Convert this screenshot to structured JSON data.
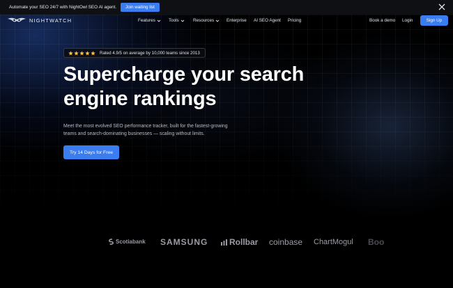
{
  "announcement": {
    "text": "Automate your SEO 24/7 with NightOwl SEO AI agent.",
    "join_label": "Join waiting list"
  },
  "nav": {
    "logo_text": "NIGHTWATCH",
    "items": [
      {
        "label": "Features",
        "dropdown": true
      },
      {
        "label": "Tools",
        "dropdown": true
      },
      {
        "label": "Resources",
        "dropdown": true
      },
      {
        "label": "Enterprise",
        "dropdown": false
      },
      {
        "label": "AI SEO Agent",
        "dropdown": false
      },
      {
        "label": "Pricing",
        "dropdown": false
      }
    ],
    "book_demo": "Book a demo",
    "login": "Login",
    "signup": "Sign Up"
  },
  "hero": {
    "stars": 5,
    "rating_text": "Rated 4.9/5 on average by 10,000 teams since 2013",
    "headline_line1": "Supercharge your search",
    "headline_line2": "engine rankings",
    "subtext": "Meet the most evolved SEO performance tracker, built for the fastest-growing teams and search-dominating businesses — scaling without limits.",
    "cta": "Try 14 Days for Free"
  },
  "logos": [
    "Scotiabank",
    "SAMSUNG",
    "Rollbar",
    "coinbase",
    "ChartMogul",
    "Boo"
  ],
  "colors": {
    "accent": "#3b7cf0",
    "star": "#f5c242",
    "background": "#000000"
  },
  "icons": {
    "close": "close-icon",
    "chevron": "chevron-down-icon",
    "star": "star-icon",
    "logo": "nightwatch-owl-icon"
  }
}
